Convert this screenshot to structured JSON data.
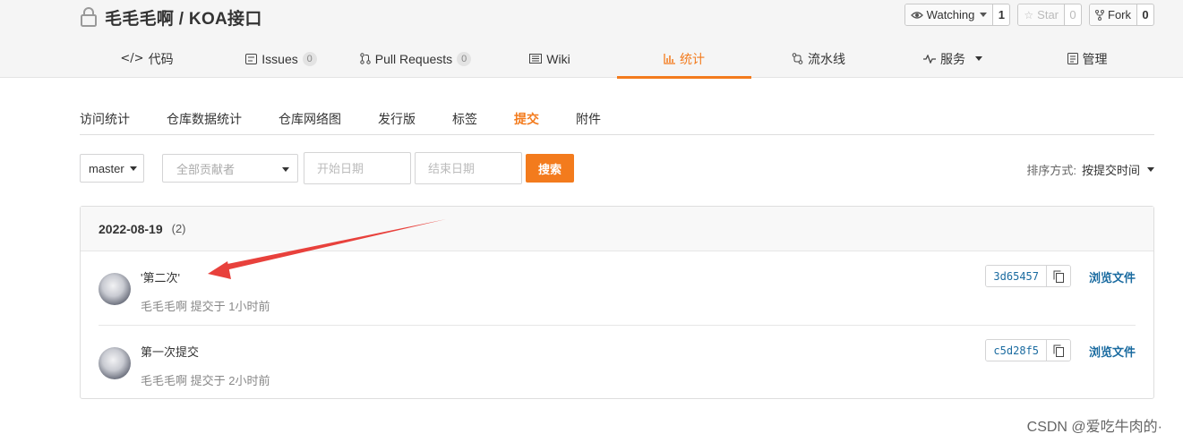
{
  "repo": {
    "title": "毛毛毛啊 / KOA接口",
    "watch_label": "Watching",
    "watch_count": "1",
    "star_label": "Star",
    "star_count": "0",
    "fork_label": "Fork",
    "fork_count": "0"
  },
  "nav": {
    "tabs": [
      {
        "label": "代码",
        "icon": "code-icon"
      },
      {
        "label": "Issues",
        "badge": "0",
        "icon": "issues-icon"
      },
      {
        "label": "Pull Requests",
        "badge": "0",
        "icon": "pull-request-icon"
      },
      {
        "label": "Wiki",
        "icon": "wiki-icon"
      },
      {
        "label": "统计",
        "icon": "bar-chart-icon",
        "active": true
      },
      {
        "label": "流水线",
        "icon": "pipeline-icon"
      },
      {
        "label": "服务",
        "icon": "pulse-icon"
      },
      {
        "label": "管理",
        "icon": "manage-icon"
      }
    ]
  },
  "subnav": {
    "items": [
      "访问统计",
      "仓库数据统计",
      "仓库网络图",
      "发行版",
      "标签",
      "提交",
      "附件"
    ],
    "active": "提交"
  },
  "filters": {
    "branch": "master",
    "contributor_placeholder": "全部贡献者",
    "start_placeholder": "开始日期",
    "end_placeholder": "结束日期",
    "search_label": "搜索",
    "sort_label": "排序方式:",
    "sort_value": "按提交时间"
  },
  "commits": {
    "date": "2022-08-19",
    "count": "(2)",
    "items": [
      {
        "message": "'第二次'",
        "meta": "毛毛毛啊 提交于 1小时前",
        "sha": "3d65457",
        "browse": "浏览文件"
      },
      {
        "message": "第一次提交",
        "meta": "毛毛毛啊 提交于 2小时前",
        "sha": "c5d28f5",
        "browse": "浏览文件"
      }
    ]
  },
  "watermark": "CSDN @爱吃牛肉的·",
  "colors": {
    "accent": "#f37b1d",
    "link": "#1a6ba0",
    "annotation_arrow": "#e8413c"
  }
}
